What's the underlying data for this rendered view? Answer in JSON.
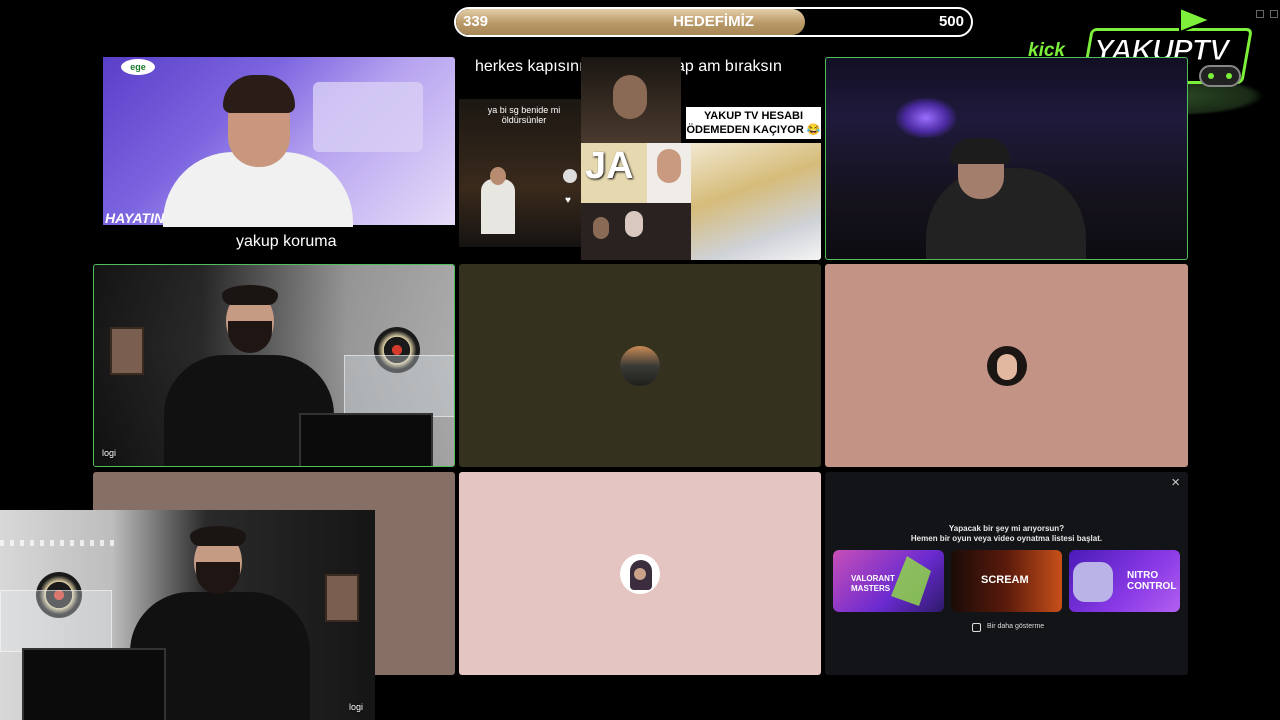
{
  "goal": {
    "current": "339",
    "title": "HEDEFİMİZ",
    "target": "500",
    "progress": 0.678
  },
  "brand": {
    "platform": "kick",
    "name": "YAKUPTV"
  },
  "tiles": {
    "tv_clip": {
      "badge": "ege",
      "lower_third": "HAYATIN",
      "caption": "yakup koruma"
    },
    "meme": {
      "caption": "herkes kapısının önüne bir kap am bıraksın",
      "tiktok_text": "ya bi sg benide mi öldürsünler",
      "overlay_text": "YAKUP TV HESABI ÖDEMEDEN KAÇIYOR 😂",
      "ja_text": "JA"
    },
    "cam_main": {
      "label": "logi"
    },
    "cam_pip": {
      "label": "logi"
    }
  },
  "activity": {
    "title": "Yapacak bir şey mi arıyorsun?",
    "subtitle": "Hemen bir oyun veya video oynatma listesi başlat.",
    "cards": [
      {
        "label_1": "VALORANT",
        "label_2": "MASTERS"
      },
      {
        "label_1": "SCREAM"
      },
      {
        "label_1": "NITRO",
        "label_2": "CONTROL"
      }
    ],
    "checkbox_label": "Bir daha gösterme",
    "close_glyph": "×"
  },
  "colors": {
    "speaking_border": "#4fbf5a",
    "goal_fill": "#b99868",
    "brand_green": "#7cf03a"
  }
}
